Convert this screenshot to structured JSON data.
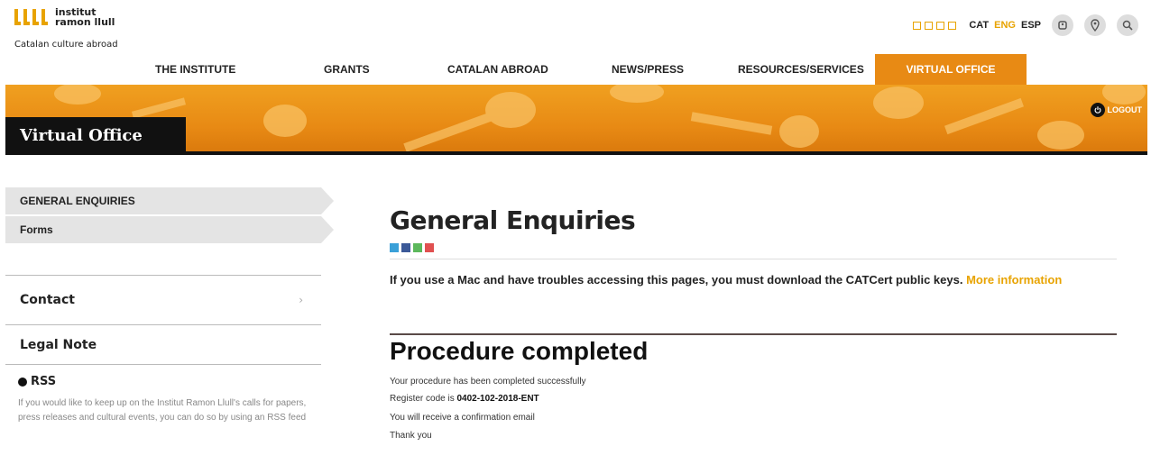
{
  "logo": {
    "line1": "institut",
    "line2": "ramon llull",
    "tagline": "Catalan culture abroad"
  },
  "langs": {
    "cat": "CAT",
    "eng": "ENG",
    "esp": "ESP",
    "active": "ENG"
  },
  "icons": {
    "accessibility": "accessibility-icon",
    "location": "location-pin-icon",
    "search": "search-icon",
    "logout": "power-icon",
    "rss": "rss-icon"
  },
  "nav": [
    {
      "label": "THE INSTITUTE"
    },
    {
      "label": "GRANTS"
    },
    {
      "label": "CATALAN ABROAD"
    },
    {
      "label": "NEWS/PRESS"
    },
    {
      "label": "RESOURCES/SERVICES"
    },
    {
      "label": "VIRTUAL OFFICE",
      "active": true
    }
  ],
  "banner": {
    "title": "Virtual Office",
    "logout": "LOGOUT"
  },
  "sidebar": {
    "items": [
      {
        "label": "GENERAL ENQUIRIES"
      },
      {
        "label": "Forms"
      }
    ],
    "links": [
      {
        "label": "Contact",
        "chevron": "›"
      },
      {
        "label": "Legal Note"
      }
    ],
    "rss": {
      "title": "RSS",
      "text": "If you would like to keep up on the Institut Ramon Llull's calls for papers, press releases and cultural events, you can do so by using an RSS feed"
    }
  },
  "main": {
    "title": "General Enquiries",
    "mac_note": "If you use a Mac and have troubles accessing this pages, you must download the CATCert public keys.",
    "more": "More information",
    "procedure_title": "Procedure completed",
    "line1": "Your procedure has been completed successfully",
    "line2_prefix": "Register code is",
    "register_code": "0402-102-2018-ENT",
    "line3": "You will receive a confirmation email",
    "line4": "Thank you"
  },
  "colors": {
    "accent": "#e8a300",
    "banner": "#e88a14",
    "dark": "#111111"
  }
}
